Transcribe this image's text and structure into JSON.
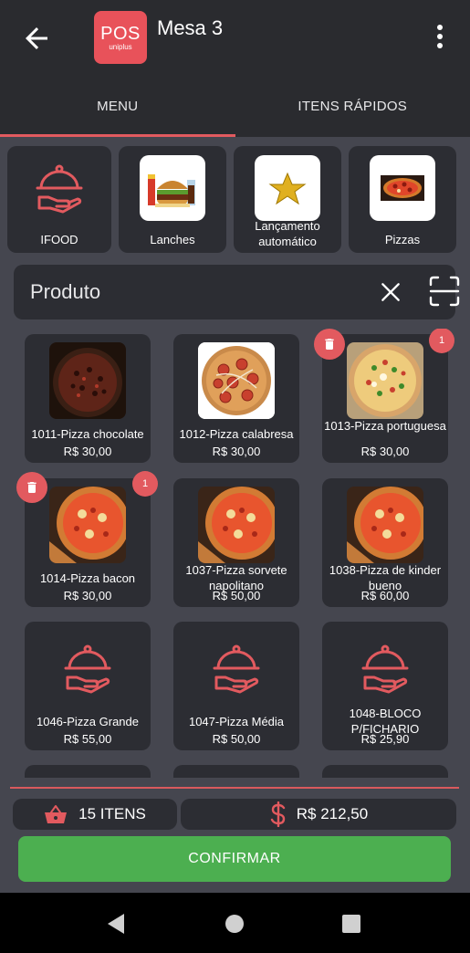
{
  "header": {
    "title": "Mesa 3",
    "logo_big": "POS",
    "logo_small": "uniplus"
  },
  "tabs": [
    {
      "label": "MENU",
      "active": true
    },
    {
      "label": "ITENS RÁPIDOS",
      "active": false
    }
  ],
  "categories": [
    {
      "label": "IFOOD",
      "icon": "cloche-hand-icon"
    },
    {
      "label": "Lanches",
      "icon": "burger-icon"
    },
    {
      "label": "Lançamento automático",
      "icon": "star-icon"
    },
    {
      "label": "Pizzas",
      "icon": "pizza-icon"
    }
  ],
  "search": {
    "placeholder": "Produto"
  },
  "products": [
    {
      "name": "1011-Pizza chocolate",
      "price": "R$ 30,00"
    },
    {
      "name": "1012-Pizza calabresa",
      "price": "R$ 30,00"
    },
    {
      "name": "1013-Pizza portuguesa",
      "price": "R$ 30,00",
      "qty": "1"
    },
    {
      "name": "1014-Pizza bacon",
      "price": "R$ 30,00",
      "qty": "1"
    },
    {
      "name": "1037-Pizza sorvete napolitano",
      "price": "R$ 50,00"
    },
    {
      "name": "1038-Pizza de kinder bueno",
      "price": "R$ 60,00"
    },
    {
      "name": "1046-Pizza Grande",
      "price": "R$ 55,00"
    },
    {
      "name": "1047-Pizza Média",
      "price": "R$ 50,00"
    },
    {
      "name": "1048-BLOCO P/FICHARIO",
      "price": "R$ 25,90"
    }
  ],
  "footer": {
    "items_count": "15 ITENS",
    "total": "R$ 212,50",
    "confirm_label": "CONFIRMAR"
  },
  "colors": {
    "accent": "#e25a5f",
    "confirm": "#4caf50",
    "card": "#2c2d33",
    "background": "#45464f"
  }
}
